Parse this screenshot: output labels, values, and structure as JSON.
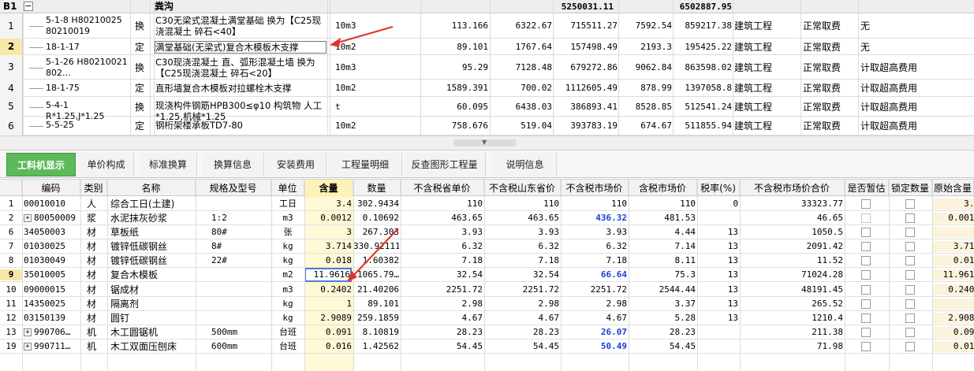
{
  "top": {
    "header": {
      "id": "B1",
      "collapse": "−",
      "name": "粪沟",
      "total1": "5250031.11",
      "total2": "6502887.95"
    },
    "rows": [
      {
        "no": "1",
        "code": "5-1-8 H80210025 80210019",
        "type": "换",
        "name": "C30无梁式混凝土满堂基础  换为【C25现浇混凝土 碎石<40】",
        "unit": "10m3",
        "qty": "113.166",
        "price": "6322.67",
        "total": "715511.27",
        "p2": "7592.54",
        "t2": "859217.38",
        "cat": "建筑工程",
        "fee": "正常取费",
        "extra": "无"
      },
      {
        "no": "2",
        "code": "18-1-17",
        "type": "定",
        "name": "满堂基础(无梁式)复合木模板木支撑",
        "unit": "10m2",
        "qty": "89.101",
        "price": "1767.64",
        "total": "157498.49",
        "p2": "2193.3",
        "t2": "195425.22",
        "cat": "建筑工程",
        "fee": "正常取费",
        "extra": "无"
      },
      {
        "no": "3",
        "code": "5-1-26 H80210021 802…",
        "type": "换",
        "name": "C30现浇混凝土 直、弧形混凝土墙  换为【C25现浇混凝土 碎石<20】",
        "unit": "10m3",
        "qty": "95.29",
        "price": "7128.48",
        "total": "679272.86",
        "p2": "9062.84",
        "t2": "863598.02",
        "cat": "建筑工程",
        "fee": "正常取费",
        "extra": "计取超高费用"
      },
      {
        "no": "4",
        "code": "18-1-75",
        "type": "定",
        "name": "直形墙复合木模板对拉螺栓木支撑",
        "unit": "10m2",
        "qty": "1589.391",
        "price": "700.02",
        "total": "1112605.49",
        "p2": "878.99",
        "t2": "1397058.8",
        "cat": "建筑工程",
        "fee": "正常取费",
        "extra": "计取超高费用"
      },
      {
        "no": "5",
        "code": "5-4-1 R*1.25,J*1.25",
        "type": "换",
        "name": "现浇构件钢筋HPB300≤φ10  构筑物 人工*1.25,机械*1.25",
        "unit": "t",
        "qty": "60.095",
        "price": "6438.03",
        "total": "386893.41",
        "p2": "8528.85",
        "t2": "512541.24",
        "cat": "建筑工程",
        "fee": "正常取费",
        "extra": "计取超高费用"
      },
      {
        "no": "6",
        "code": "5-5-25",
        "type": "定",
        "name": "钢桁架楼承板TD7-80",
        "unit": "10m2",
        "qty": "758.676",
        "price": "519.04",
        "total": "393783.19",
        "p2": "674.67",
        "t2": "511855.94",
        "cat": "建筑工程",
        "fee": "正常取费",
        "extra": "计取超高费用"
      }
    ]
  },
  "tabs": [
    "工料机显示",
    "单价构成",
    "标准换算",
    "换算信息",
    "安装费用",
    "工程量明细",
    "反查图形工程量",
    "说明信息"
  ],
  "columns": [
    "编码",
    "类别",
    "名称",
    "规格及型号",
    "单位",
    "含量",
    "数量",
    "不含税省单价",
    "不含税山东省价",
    "不含税市场价",
    "含税市场价",
    "税率(%)",
    "不含税市场价合价",
    "是否暂估",
    "锁定数量",
    "原始含量"
  ],
  "bottom": [
    {
      "no": "1",
      "plus": false,
      "code": "00010010",
      "type": "人",
      "name": "综合工日(土建)",
      "spec": "",
      "unit": "工日",
      "content": "3.4",
      "qty": "302.9434",
      "p1": "110",
      "p2": "110",
      "p3": "110",
      "blue": false,
      "p4": "110",
      "tax": "0",
      "sum": "33323.77",
      "est": false,
      "lock": false,
      "orig": "3.4"
    },
    {
      "no": "2",
      "plus": true,
      "code": "80050009",
      "type": "浆",
      "name": "水泥抹灰砂浆",
      "spec": "1:2",
      "unit": "m3",
      "content": "0.0012",
      "qty": "0.10692",
      "p1": "463.65",
      "p2": "463.65",
      "p3": "436.32",
      "blue": true,
      "p4": "481.53",
      "tax": "",
      "sum": "46.65",
      "est": "dis",
      "lock": false,
      "orig": "0.0012"
    },
    {
      "no": "6",
      "plus": false,
      "code": "34050003",
      "type": "材",
      "name": "草板纸",
      "spec": "80#",
      "unit": "张",
      "content": "3",
      "qty": "267.303",
      "p1": "3.93",
      "p2": "3.93",
      "p3": "3.93",
      "blue": false,
      "p4": "4.44",
      "tax": "13",
      "sum": "1050.5",
      "est": false,
      "lock": false,
      "orig": "3"
    },
    {
      "no": "7",
      "plus": false,
      "code": "01030025",
      "type": "材",
      "name": "镀锌低碳钢丝",
      "spec": "8#",
      "unit": "kg",
      "content": "3.714",
      "qty": "330.92111",
      "p1": "6.32",
      "p2": "6.32",
      "p3": "6.32",
      "blue": false,
      "p4": "7.14",
      "tax": "13",
      "sum": "2091.42",
      "est": false,
      "lock": false,
      "orig": "3.714"
    },
    {
      "no": "8",
      "plus": false,
      "code": "01030049",
      "type": "材",
      "name": "镀锌低碳钢丝",
      "spec": "22#",
      "unit": "kg",
      "content": "0.018",
      "qty": "1.60382",
      "p1": "7.18",
      "p2": "7.18",
      "p3": "7.18",
      "blue": false,
      "p4": "8.11",
      "tax": "13",
      "sum": "11.52",
      "est": false,
      "lock": false,
      "orig": "0.018"
    },
    {
      "no": "9",
      "plus": false,
      "code": "35010005",
      "type": "材",
      "name": "复合木模板",
      "spec": "",
      "unit": "m2",
      "content": "11.9616",
      "qty": "1065.79…",
      "p1": "32.54",
      "p2": "32.54",
      "p3": "66.64",
      "blue": true,
      "p4": "75.3",
      "tax": "13",
      "sum": "71024.28",
      "est": false,
      "lock": false,
      "orig": "11.9616",
      "sel": true
    },
    {
      "no": "10",
      "plus": false,
      "code": "09000015",
      "type": "材",
      "name": "锯成材",
      "spec": "",
      "unit": "m3",
      "content": "0.2402",
      "qty": "21.40206",
      "p1": "2251.72",
      "p2": "2251.72",
      "p3": "2251.72",
      "blue": false,
      "p4": "2544.44",
      "tax": "13",
      "sum": "48191.45",
      "est": false,
      "lock": false,
      "orig": "0.2402"
    },
    {
      "no": "11",
      "plus": false,
      "code": "14350025",
      "type": "材",
      "name": "隔离剂",
      "spec": "",
      "unit": "kg",
      "content": "1",
      "qty": "89.101",
      "p1": "2.98",
      "p2": "2.98",
      "p3": "2.98",
      "blue": false,
      "p4": "3.37",
      "tax": "13",
      "sum": "265.52",
      "est": false,
      "lock": false,
      "orig": "1"
    },
    {
      "no": "12",
      "plus": false,
      "code": "03150139",
      "type": "材",
      "name": "圆钉",
      "spec": "",
      "unit": "kg",
      "content": "2.9089",
      "qty": "259.1859",
      "p1": "4.67",
      "p2": "4.67",
      "p3": "4.67",
      "blue": false,
      "p4": "5.28",
      "tax": "13",
      "sum": "1210.4",
      "est": false,
      "lock": false,
      "orig": "2.9089"
    },
    {
      "no": "13",
      "plus": true,
      "code": "990706…",
      "type": "机",
      "name": "木工圆锯机",
      "spec": "500mm",
      "unit": "台班",
      "content": "0.091",
      "qty": "8.10819",
      "p1": "28.23",
      "p2": "28.23",
      "p3": "26.07",
      "blue": true,
      "p4": "28.23",
      "tax": "",
      "sum": "211.38",
      "est": false,
      "lock": false,
      "orig": "0.091"
    },
    {
      "no": "19",
      "plus": true,
      "code": "990711…",
      "type": "机",
      "name": "木工双面压刨床",
      "spec": "600mm",
      "unit": "台班",
      "content": "0.016",
      "qty": "1.42562",
      "p1": "54.45",
      "p2": "54.45",
      "p3": "50.49",
      "blue": true,
      "p4": "54.45",
      "tax": "",
      "sum": "71.98",
      "est": false,
      "lock": false,
      "orig": "0.016"
    }
  ],
  "colors": {
    "arrow": "#e0322c",
    "tab_active": "#5db95a",
    "highlight_col": "#fff2b8",
    "blue_value": "#1a3fd6"
  }
}
